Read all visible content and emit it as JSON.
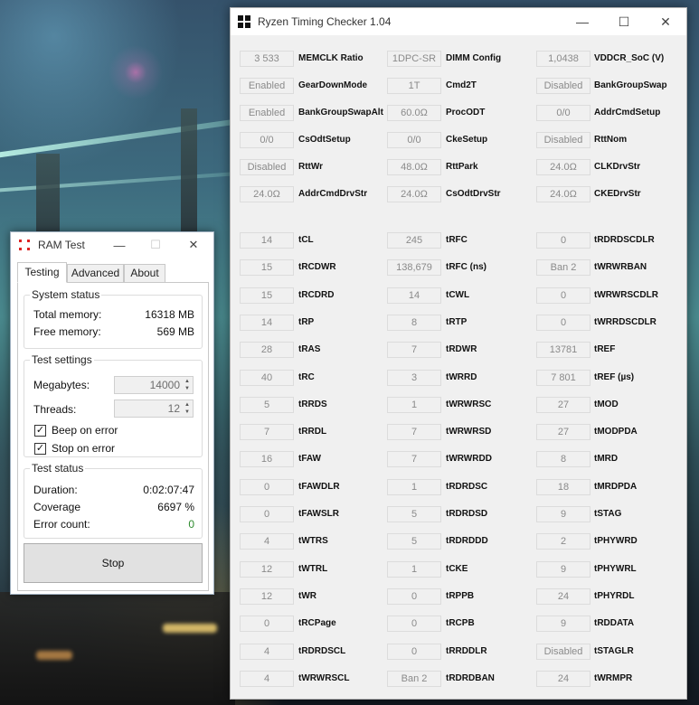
{
  "rtc": {
    "title": "Ryzen Timing Checker 1.04",
    "top_section": [
      [
        {
          "value": "3 533",
          "label": "MEMCLK Ratio"
        },
        {
          "value": "1DPC-SR",
          "label": "DIMM Config"
        },
        {
          "value": "1,0438",
          "label": "VDDCR_SoC (V)"
        }
      ],
      [
        {
          "value": "Enabled",
          "label": "GearDownMode"
        },
        {
          "value": "1T",
          "label": "Cmd2T"
        },
        {
          "value": "Disabled",
          "label": "BankGroupSwap"
        }
      ],
      [
        {
          "value": "Enabled",
          "label": "BankGroupSwapAlt"
        },
        {
          "value": "60.0Ω",
          "label": "ProcODT"
        },
        {
          "value": "0/0",
          "label": "AddrCmdSetup"
        }
      ],
      [
        {
          "value": "0/0",
          "label": "CsOdtSetup"
        },
        {
          "value": "0/0",
          "label": "CkeSetup"
        },
        {
          "value": "Disabled",
          "label": "RttNom"
        }
      ],
      [
        {
          "value": "Disabled",
          "label": "RttWr"
        },
        {
          "value": "48.0Ω",
          "label": "RttPark"
        },
        {
          "value": "24.0Ω",
          "label": "CLKDrvStr"
        }
      ],
      [
        {
          "value": "24.0Ω",
          "label": "AddrCmdDrvStr"
        },
        {
          "value": "24.0Ω",
          "label": "CsOdtDrvStr"
        },
        {
          "value": "24.0Ω",
          "label": "CKEDrvStr"
        }
      ]
    ],
    "timings": [
      [
        {
          "value": "14",
          "label": "tCL"
        },
        {
          "value": "245",
          "label": "tRFC"
        },
        {
          "value": "0",
          "label": "tRDRDSCDLR"
        }
      ],
      [
        {
          "value": "15",
          "label": "tRCDWR"
        },
        {
          "value": "138,679",
          "label": "tRFC (ns)"
        },
        {
          "value": "Ban 2",
          "label": "tWRWRBAN"
        }
      ],
      [
        {
          "value": "15",
          "label": "tRCDRD"
        },
        {
          "value": "14",
          "label": "tCWL"
        },
        {
          "value": "0",
          "label": "tWRWRSCDLR"
        }
      ],
      [
        {
          "value": "14",
          "label": "tRP"
        },
        {
          "value": "8",
          "label": "tRTP"
        },
        {
          "value": "0",
          "label": "tWRRDSCDLR"
        }
      ],
      [
        {
          "value": "28",
          "label": "tRAS"
        },
        {
          "value": "7",
          "label": "tRDWR"
        },
        {
          "value": "13781",
          "label": "tREF"
        }
      ],
      [
        {
          "value": "40",
          "label": "tRC"
        },
        {
          "value": "3",
          "label": "tWRRD"
        },
        {
          "value": "7 801",
          "label": "tREF (µs)"
        }
      ],
      [
        {
          "value": "5",
          "label": "tRRDS"
        },
        {
          "value": "1",
          "label": "tWRWRSC"
        },
        {
          "value": "27",
          "label": "tMOD"
        }
      ],
      [
        {
          "value": "7",
          "label": "tRRDL"
        },
        {
          "value": "7",
          "label": "tWRWRSD"
        },
        {
          "value": "27",
          "label": "tMODPDA"
        }
      ],
      [
        {
          "value": "16",
          "label": "tFAW"
        },
        {
          "value": "7",
          "label": "tWRWRDD"
        },
        {
          "value": "8",
          "label": "tMRD"
        }
      ],
      [
        {
          "value": "0",
          "label": "tFAWDLR"
        },
        {
          "value": "1",
          "label": "tRDRDSC"
        },
        {
          "value": "18",
          "label": "tMRDPDA"
        }
      ],
      [
        {
          "value": "0",
          "label": "tFAWSLR"
        },
        {
          "value": "5",
          "label": "tRDRDSD"
        },
        {
          "value": "9",
          "label": "tSTAG"
        }
      ],
      [
        {
          "value": "4",
          "label": "tWTRS"
        },
        {
          "value": "5",
          "label": "tRDRDDD"
        },
        {
          "value": "2",
          "label": "tPHYWRD"
        }
      ],
      [
        {
          "value": "12",
          "label": "tWTRL"
        },
        {
          "value": "1",
          "label": "tCKE"
        },
        {
          "value": "9",
          "label": "tPHYWRL"
        }
      ],
      [
        {
          "value": "12",
          "label": "tWR"
        },
        {
          "value": "0",
          "label": "tRPPB"
        },
        {
          "value": "24",
          "label": "tPHYRDL"
        }
      ],
      [
        {
          "value": "0",
          "label": "tRCPage"
        },
        {
          "value": "0",
          "label": "tRCPB"
        },
        {
          "value": "9",
          "label": "tRDDATA"
        }
      ],
      [
        {
          "value": "4",
          "label": "tRDRDSCL"
        },
        {
          "value": "0",
          "label": "tRRDDLR"
        },
        {
          "value": "Disabled",
          "label": "tSTAGLR"
        }
      ],
      [
        {
          "value": "4",
          "label": "tWRWRSCL"
        },
        {
          "value": "Ban 2",
          "label": "tRDRDBAN"
        },
        {
          "value": "24",
          "label": "tWRMPR"
        }
      ]
    ]
  },
  "ram": {
    "title": "RAM Test",
    "tabs": {
      "testing": "Testing",
      "advanced": "Advanced",
      "about": "About"
    },
    "system_status": {
      "title": "System status",
      "total_label": "Total memory:",
      "total_value": "16318 MB",
      "free_label": "Free memory:",
      "free_value": "569 MB"
    },
    "test_settings": {
      "title": "Test settings",
      "megabytes_label": "Megabytes:",
      "megabytes_value": "14000",
      "threads_label": "Threads:",
      "threads_value": "12",
      "beep_label": "Beep on error",
      "stop_label": "Stop on error",
      "check_mark": "✓"
    },
    "test_status": {
      "title": "Test status",
      "duration_label": "Duration:",
      "duration_value": "0:02:07:47",
      "coverage_label": "Coverage",
      "coverage_value": "6697 %",
      "errors_label": "Error count:",
      "errors_value": "0"
    },
    "stop_button": "Stop"
  },
  "window_controls": {
    "minimize": "—",
    "maximize": "☐",
    "close": "✕"
  }
}
